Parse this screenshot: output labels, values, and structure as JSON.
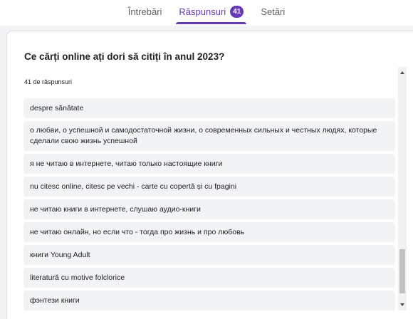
{
  "tabs": [
    {
      "label": "Întrebări"
    },
    {
      "label": "Răspunsuri",
      "badge": "41"
    },
    {
      "label": "Setări"
    }
  ],
  "question": {
    "title": "Ce cărți online ați dori să citiți în anul 2023?",
    "response_count": "41 de răspunsuri"
  },
  "responses": [
    "despre sănătate",
    "о любви, о успешной и самодостаточной жизни, о современных сильных и честных людях, которые сделали свою жизнь успешной",
    "я не читаю в интернете, читаю только настоящие книги",
    "nu citesc online, citesc pe vechi - carte cu copertă și cu fpagini",
    "не читаю книги в интернете, слушаю аудио-книги",
    "не читаю онлайн, но если что - тогда про жизнь и про любовь",
    "книги Young Adult",
    "literatură cu motive folclorice",
    "фэнтези книги"
  ],
  "colors": {
    "accent": "#673ab7",
    "background": "#f1f3f4",
    "item_background": "#f1f3f4"
  },
  "icons": {
    "scroll_up": "arrow-up-icon",
    "scroll_down": "arrow-down-icon"
  }
}
